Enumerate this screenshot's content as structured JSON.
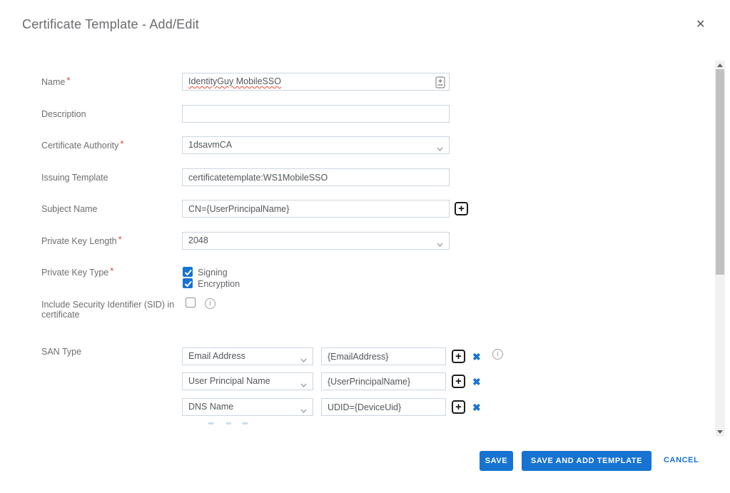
{
  "ui": {
    "required_marker": "*",
    "icons": {
      "close": "✕",
      "add": "+",
      "remove": "✖",
      "info": "i"
    }
  },
  "dialog": {
    "title": "Certificate Template - Add/Edit"
  },
  "form": {
    "name": {
      "label": "Name",
      "required": true,
      "value": "IdentityGuy MobileSSO"
    },
    "description": {
      "label": "Description",
      "value": ""
    },
    "certificate_authority": {
      "label": "Certificate Authority",
      "required": true,
      "selected": "1dsavmCA"
    },
    "issuing_template": {
      "label": "Issuing Template",
      "value": "certificatetemplate:WS1MobileSSO"
    },
    "subject_name": {
      "label": "Subject Name",
      "value": "CN={UserPrincipalName}"
    },
    "private_key_length": {
      "label": "Private Key Length",
      "required": true,
      "selected": "2048"
    },
    "private_key_type": {
      "label": "Private Key Type",
      "required": true,
      "options": [
        {
          "label": "Signing",
          "checked": true
        },
        {
          "label": "Encryption",
          "checked": true
        }
      ]
    },
    "include_sid": {
      "label": "Include Security Identifier (SID) in certificate",
      "checked": false
    },
    "san_type": {
      "label": "SAN Type",
      "rows": [
        {
          "type": "Email Address",
          "value": "{EmailAddress}",
          "has_info": true
        },
        {
          "type": "User Principal Name",
          "value": "{UserPrincipalName}",
          "has_info": false
        },
        {
          "type": "DNS Name",
          "value": "UDID={DeviceUid}",
          "has_info": false
        }
      ]
    }
  },
  "footer": {
    "save": "SAVE",
    "save_and_add_template": "SAVE AND ADD TEMPLATE",
    "cancel": "CANCEL"
  },
  "colors": {
    "primary": "#1673d1",
    "required_marker": "#e0432d",
    "label_text": "#6e6e73",
    "input_border": "#ccd6e0",
    "title_text": "#6b6b70",
    "spellcheck_underline": "#e8442f"
  }
}
